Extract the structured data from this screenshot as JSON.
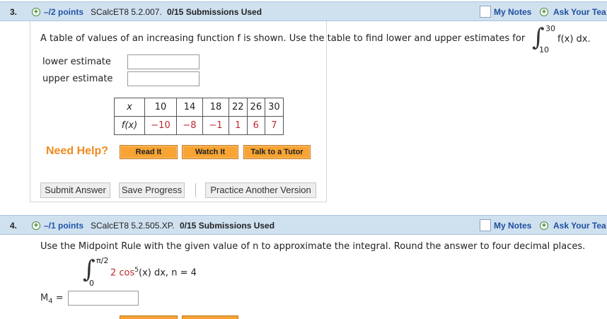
{
  "q3": {
    "number": "3.",
    "points": "–/2 points",
    "assignment": "SCalcET8 5.2.007.",
    "submissions": "0/15 Submissions Used",
    "my_notes": "My Notes",
    "ask_teacher": "Ask Your Tea",
    "question_text": "A table of values of an increasing function f is shown. Use the table to find lower and upper estimates for",
    "integral_upper": "30",
    "integral_lower": "10",
    "integrand": "f(x) dx.",
    "lower_label": "lower estimate",
    "upper_label": "upper estimate",
    "lower_value": "",
    "upper_value": "",
    "table": {
      "x_label": "x",
      "fx_label": "f(x)",
      "x_values": [
        "10",
        "14",
        "18",
        "22",
        "26",
        "30"
      ],
      "fx_values": [
        "−10",
        "−8",
        "−1",
        "1",
        "6",
        "7"
      ]
    },
    "need_help": "Need Help?",
    "help_buttons": [
      "Read It",
      "Watch It",
      "Talk to a Tutor"
    ],
    "actions": [
      "Submit Answer",
      "Save Progress",
      "Practice Another Version"
    ]
  },
  "q4": {
    "number": "4.",
    "points": "–/1 points",
    "assignment": "SCalcET8 5.2.505.XP.",
    "submissions": "0/15 Submissions Used",
    "my_notes": "My Notes",
    "ask_teacher": "Ask Your Tea",
    "question_text": "Use the Midpoint Rule with the given value of n to approximate the integral. Round the answer to four decimal places.",
    "integral_upper": "π/2",
    "integral_lower": "0",
    "integrand_coef": "2 cos",
    "integrand_exp": "5",
    "integrand_rest": "(x) dx, n = 4",
    "m_label": "M",
    "m_sub": "4",
    "m_eq": "=",
    "m_value": ""
  },
  "colors": {
    "header_bg": "#cfe0ef",
    "link_blue": "#1f4fa0",
    "help_orange": "#f08a20",
    "button_orange": "#f7a434",
    "fx_red": "#c0282d"
  }
}
